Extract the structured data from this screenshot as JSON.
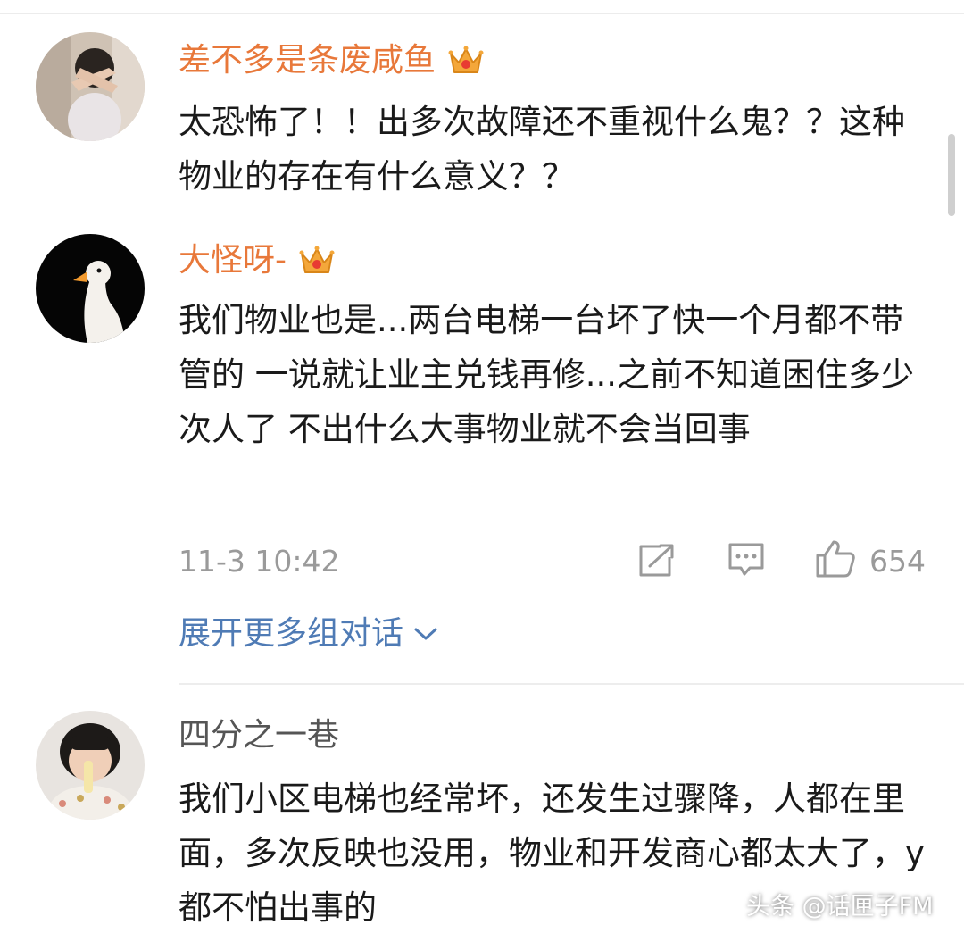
{
  "comments": [
    {
      "username": "差不多是条废咸鱼",
      "vip_badge": "crown-icon",
      "text": "太恐怖了！！出多次故障还不重视什么鬼？？这种物业的存在有什么意义？？"
    },
    {
      "username": "大怪呀-",
      "vip_badge": "crown-icon",
      "text": "我们物业也是...两台电梯一台坏了快一个月都不带管的  一说就让业主兑钱再修...之前不知道困住多少次人了  不出什么大事物业就不会当回事",
      "timestamp": "11-3 10:42",
      "like_count": "654",
      "actions": [
        "share-icon",
        "comment-icon",
        "thumbs-up-icon"
      ]
    },
    {
      "username": "四分之一巷",
      "text": "我们小区电梯也经常坏，还发生过骤降，人都在里面，多次反映也没用，物业和开发商心都太大了，y都不怕出事的"
    }
  ],
  "expand_link": "展开更多组对话",
  "watermark": "头条 @话匣子FM",
  "colors": {
    "vip_name": "#e8783a",
    "plain_name": "#555555",
    "link": "#4f7bb5",
    "meta": "#9a9a9a",
    "text": "#1a1a1a"
  }
}
